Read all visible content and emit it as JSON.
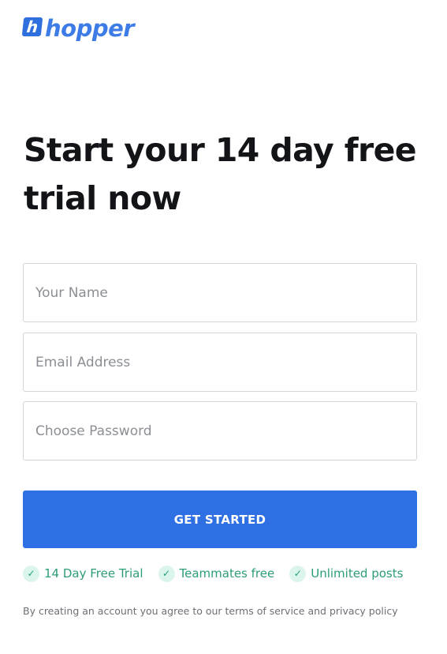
{
  "brand": {
    "mark": "h",
    "name": "hopper",
    "color": "#3d7ce6"
  },
  "headline": "Start your 14 day free trial now",
  "form": {
    "name_placeholder": "Your Name",
    "email_placeholder": "Email Address",
    "password_placeholder": "Choose Password",
    "submit_label": "GET STARTED",
    "submit_color": "#2f6fe4"
  },
  "features": [
    {
      "icon": "check-icon",
      "label": "14 Day Free Trial"
    },
    {
      "icon": "check-icon",
      "label": "Teammates free"
    },
    {
      "icon": "check-icon",
      "label": "Unlimited posts"
    }
  ],
  "feature_color": "#2d9c78",
  "terms": "By creating an account you agree to our terms of service and privacy policy"
}
